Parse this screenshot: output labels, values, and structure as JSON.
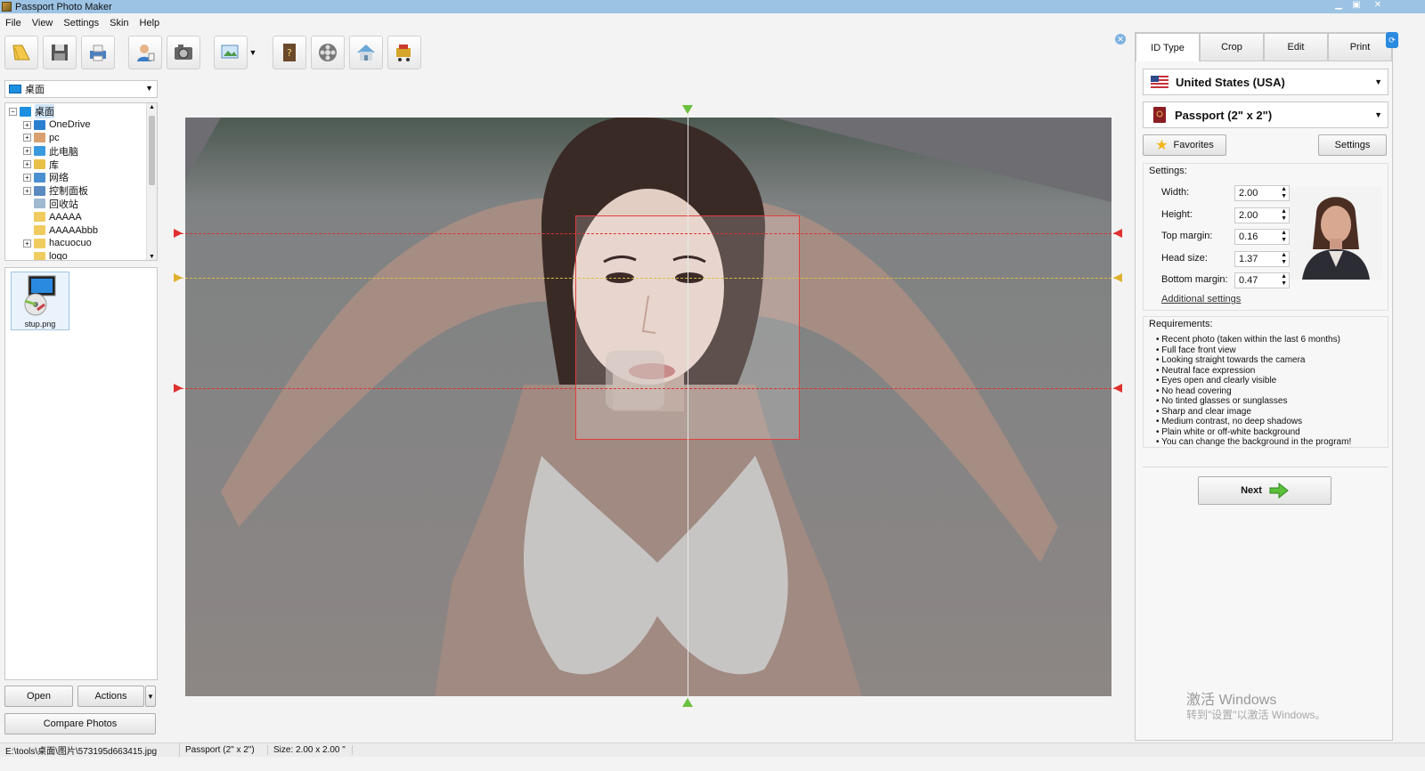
{
  "window": {
    "title": "Passport Photo Maker"
  },
  "menu": [
    "File",
    "View",
    "Settings",
    "Skin",
    "Help"
  ],
  "toolbar": {
    "icons": [
      "open-folder-icon",
      "save-icon",
      "print-icon",
      "user-icon",
      "camera-icon",
      "image-adjust-icon",
      "help-book-icon",
      "video-reel-icon",
      "home-icon",
      "cart-icon"
    ]
  },
  "left": {
    "folder": "桌面",
    "tree": [
      {
        "label": "桌面",
        "level": 0,
        "expand": "−"
      },
      {
        "label": "OneDrive",
        "level": 1,
        "expand": "+"
      },
      {
        "label": "pc",
        "level": 1,
        "expand": "+"
      },
      {
        "label": "此电脑",
        "level": 1,
        "expand": "+"
      },
      {
        "label": "库",
        "level": 1,
        "expand": "+"
      },
      {
        "label": "网络",
        "level": 1,
        "expand": "+"
      },
      {
        "label": "控制面板",
        "level": 1,
        "expand": "+"
      },
      {
        "label": "回收站",
        "level": 1,
        "expand": ""
      },
      {
        "label": "AAAAA",
        "level": 1,
        "expand": ""
      },
      {
        "label": "AAAAAbbb",
        "level": 1,
        "expand": ""
      },
      {
        "label": "hacuocuo",
        "level": 1,
        "expand": "+"
      },
      {
        "label": "logo",
        "level": 1,
        "expand": ""
      }
    ],
    "thumb": {
      "caption": "stup.png"
    },
    "open_btn": "Open",
    "actions_btn": "Actions",
    "compare_btn": "Compare Photos"
  },
  "right": {
    "tabs": [
      "ID Type",
      "Crop",
      "Edit",
      "Print"
    ],
    "country": "United States (USA)",
    "doc_type": "Passport (2\" x 2\")",
    "favorites": "Favorites",
    "settings_btn": "Settings",
    "settings_label": "Settings:",
    "fields": [
      {
        "label": "Width:",
        "value": "2.00"
      },
      {
        "label": "Height:",
        "value": "2.00"
      },
      {
        "label": "Top margin:",
        "value": "0.16"
      },
      {
        "label": "Head size:",
        "value": "1.37"
      },
      {
        "label": "Bottom margin:",
        "value": "0.47"
      }
    ],
    "additional": "Additional settings",
    "req_label": "Requirements:",
    "requirements": [
      "Recent photo (taken within the last 6 months)",
      "Full face front view",
      "Looking straight towards the camera",
      "Neutral face expression",
      "Eyes open and clearly visible",
      "No head covering",
      "No tinted glasses or sunglasses",
      "Sharp and clear image",
      "Medium contrast, no deep shadows",
      "Plain white or off-white background",
      "You can change the background in the program!"
    ],
    "next": "Next"
  },
  "watermark": {
    "line1": "激活 Windows",
    "line2": "转到\"设置\"以激活 Windows。"
  },
  "status": {
    "path": "E:\\tools\\桌面\\图片\\573195d663415.jpg",
    "type": "Passport (2\" x 2\")",
    "size": "Size: 2.00 x 2.00 \""
  }
}
